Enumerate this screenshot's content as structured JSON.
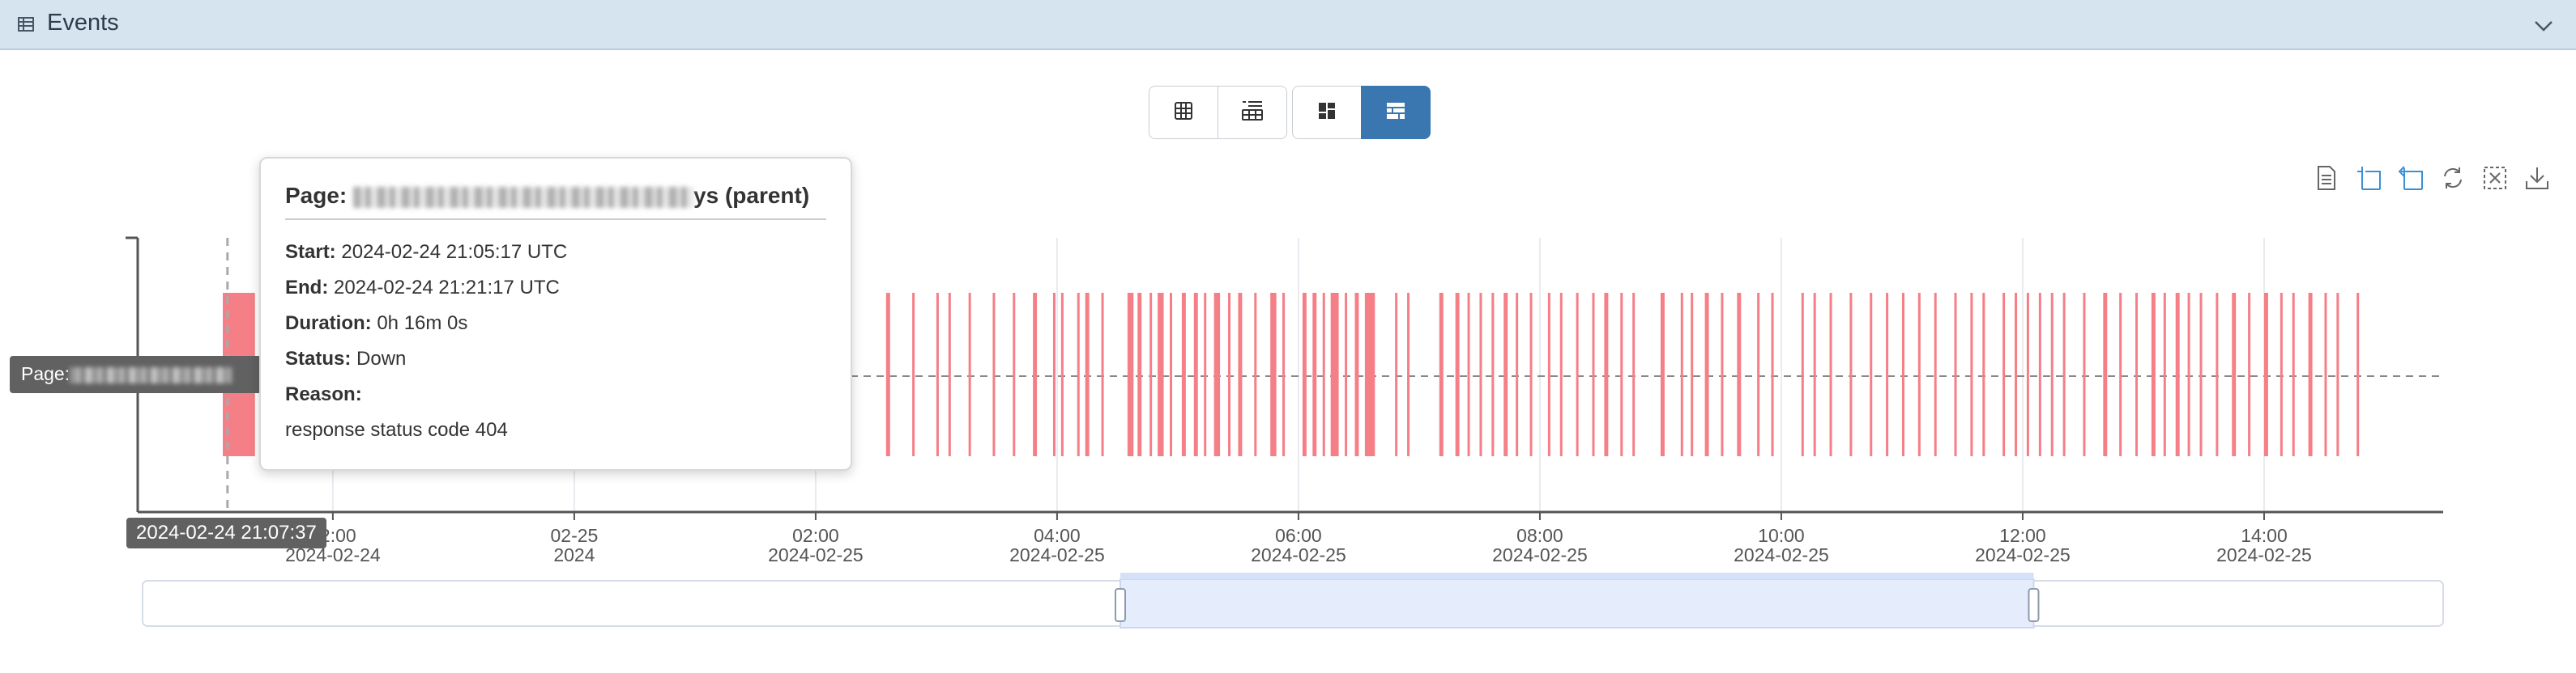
{
  "panel": {
    "title": "Events"
  },
  "view_buttons": [
    {
      "icon": "table-grid-icon",
      "active": false
    },
    {
      "icon": "table-list-icon",
      "active": false
    },
    {
      "icon": "dashboard-tiles-icon",
      "active": false
    },
    {
      "icon": "timeline-grid-icon",
      "active": true
    }
  ],
  "toolbox": [
    {
      "icon": "data-view-icon"
    },
    {
      "icon": "zoom-select-icon"
    },
    {
      "icon": "zoom-reset-icon"
    },
    {
      "icon": "restore-icon"
    },
    {
      "icon": "clear-selection-icon"
    },
    {
      "icon": "download-icon"
    }
  ],
  "tooltip": {
    "title_prefix": "Page: ",
    "title_suffix": "ys (parent)",
    "start_label": "Start:",
    "start_value": "2024-02-24 21:05:17 UTC",
    "end_label": "End:",
    "end_value": "2024-02-24 21:21:17 UTC",
    "duration_label": "Duration:",
    "duration_value": "0h 16m 0s",
    "status_label": "Status:",
    "status_value": "Down",
    "reason_label": "Reason:",
    "reason_value": "response status code 404"
  },
  "axis_pointer_label": "2024-02-24 21:07:37",
  "row_label_prefix": "Page:",
  "colors": {
    "accent": "#3a76b0",
    "event": "#f57f87",
    "zoom_fill": "#e5edfc"
  },
  "chart_data": {
    "type": "bar",
    "series": [
      {
        "status": "Down"
      }
    ],
    "x_ticks": [
      {
        "time": "2024-02-24 22:00",
        "line1": "22:00",
        "line2": "2024-02-24"
      },
      {
        "time": "2024-02-25 00:00",
        "line1": "02-25",
        "line2": "2024"
      },
      {
        "time": "2024-02-25 02:00",
        "line1": "02:00",
        "line2": "2024-02-25"
      },
      {
        "time": "2024-02-25 04:00",
        "line1": "04:00",
        "line2": "2024-02-25"
      },
      {
        "time": "2024-02-25 06:00",
        "line1": "06:00",
        "line2": "2024-02-25"
      },
      {
        "time": "2024-02-25 08:00",
        "line1": "08:00",
        "line2": "2024-02-25"
      },
      {
        "time": "2024-02-25 10:00",
        "line1": "10:00",
        "line2": "2024-02-25"
      },
      {
        "time": "2024-02-25 12:00",
        "line1": "12:00",
        "line2": "2024-02-25"
      },
      {
        "time": "2024-02-25 14:00",
        "line1": "14:00",
        "line2": "2024-02-25"
      }
    ],
    "x_range": [
      "2024-02-24 20:23",
      "2024-02-25 15:29"
    ],
    "pointer_time": "2024-02-24 21:07:37",
    "zoom_window": {
      "start_fraction": 0.425,
      "end_fraction": 0.822
    },
    "events": [
      {
        "start": "2024-02-24 21:05:17",
        "end": "2024-02-24 21:21:17"
      },
      {
        "start": "2024-02-25 02:35",
        "end": "2024-02-25 02:37"
      },
      {
        "start": "2024-02-25 02:48",
        "end": "2024-02-25 02:49"
      },
      {
        "start": "2024-02-25 03:00",
        "end": "2024-02-25 03:01"
      },
      {
        "start": "2024-02-25 03:06",
        "end": "2024-02-25 03:07"
      },
      {
        "start": "2024-02-25 03:16",
        "end": "2024-02-25 03:17"
      },
      {
        "start": "2024-02-25 03:28",
        "end": "2024-02-25 03:29"
      },
      {
        "start": "2024-02-25 03:38",
        "end": "2024-02-25 03:39"
      },
      {
        "start": "2024-02-25 03:48",
        "end": "2024-02-25 03:50"
      },
      {
        "start": "2024-02-25 03:58",
        "end": "2024-02-25 03:59"
      },
      {
        "start": "2024-02-25 04:02",
        "end": "2024-02-25 04:03"
      },
      {
        "start": "2024-02-25 04:10",
        "end": "2024-02-25 04:11"
      },
      {
        "start": "2024-02-25 04:14",
        "end": "2024-02-25 04:16"
      },
      {
        "start": "2024-02-25 04:22",
        "end": "2024-02-25 04:23"
      },
      {
        "start": "2024-02-25 04:35",
        "end": "2024-02-25 04:38"
      },
      {
        "start": "2024-02-25 04:40",
        "end": "2024-02-25 04:42"
      },
      {
        "start": "2024-02-25 04:46",
        "end": "2024-02-25 04:47"
      },
      {
        "start": "2024-02-25 04:50",
        "end": "2024-02-25 04:53"
      },
      {
        "start": "2024-02-25 04:56",
        "end": "2024-02-25 04:57"
      },
      {
        "start": "2024-02-25 05:02",
        "end": "2024-02-25 05:04"
      },
      {
        "start": "2024-02-25 05:08",
        "end": "2024-02-25 05:10"
      },
      {
        "start": "2024-02-25 05:13",
        "end": "2024-02-25 05:14"
      },
      {
        "start": "2024-02-25 05:18",
        "end": "2024-02-25 05:21"
      },
      {
        "start": "2024-02-25 05:25",
        "end": "2024-02-25 05:26"
      },
      {
        "start": "2024-02-25 05:30",
        "end": "2024-02-25 05:32"
      },
      {
        "start": "2024-02-25 05:38",
        "end": "2024-02-25 05:39"
      },
      {
        "start": "2024-02-25 05:46",
        "end": "2024-02-25 05:49"
      },
      {
        "start": "2024-02-25 05:52",
        "end": "2024-02-25 05:53"
      },
      {
        "start": "2024-02-25 06:02",
        "end": "2024-02-25 06:04"
      },
      {
        "start": "2024-02-25 06:07",
        "end": "2024-02-25 06:09"
      },
      {
        "start": "2024-02-25 06:12",
        "end": "2024-02-25 06:13"
      },
      {
        "start": "2024-02-25 06:16",
        "end": "2024-02-25 06:20"
      },
      {
        "start": "2024-02-25 06:23",
        "end": "2024-02-25 06:24"
      },
      {
        "start": "2024-02-25 06:28",
        "end": "2024-02-25 06:30"
      },
      {
        "start": "2024-02-25 06:33",
        "end": "2024-02-25 06:38"
      },
      {
        "start": "2024-02-25 06:48",
        "end": "2024-02-25 06:49"
      },
      {
        "start": "2024-02-25 06:54",
        "end": "2024-02-25 06:55"
      },
      {
        "start": "2024-02-25 07:10",
        "end": "2024-02-25 07:12"
      },
      {
        "start": "2024-02-25 07:18",
        "end": "2024-02-25 07:20"
      },
      {
        "start": "2024-02-25 07:24",
        "end": "2024-02-25 07:25"
      },
      {
        "start": "2024-02-25 07:30",
        "end": "2024-02-25 07:31"
      },
      {
        "start": "2024-02-25 07:36",
        "end": "2024-02-25 07:37"
      },
      {
        "start": "2024-02-25 07:42",
        "end": "2024-02-25 07:44"
      },
      {
        "start": "2024-02-25 07:48",
        "end": "2024-02-25 07:49"
      },
      {
        "start": "2024-02-25 07:55",
        "end": "2024-02-25 07:56"
      },
      {
        "start": "2024-02-25 08:04",
        "end": "2024-02-25 08:05"
      },
      {
        "start": "2024-02-25 08:10",
        "end": "2024-02-25 08:11"
      },
      {
        "start": "2024-02-25 08:18",
        "end": "2024-02-25 08:19"
      },
      {
        "start": "2024-02-25 08:26",
        "end": "2024-02-25 08:27"
      },
      {
        "start": "2024-02-25 08:32",
        "end": "2024-02-25 08:34"
      },
      {
        "start": "2024-02-25 08:40",
        "end": "2024-02-25 08:41"
      },
      {
        "start": "2024-02-25 08:46",
        "end": "2024-02-25 08:47"
      },
      {
        "start": "2024-02-25 09:00",
        "end": "2024-02-25 09:02"
      },
      {
        "start": "2024-02-25 09:10",
        "end": "2024-02-25 09:11"
      },
      {
        "start": "2024-02-25 09:15",
        "end": "2024-02-25 09:16"
      },
      {
        "start": "2024-02-25 09:22",
        "end": "2024-02-25 09:24"
      },
      {
        "start": "2024-02-25 09:30",
        "end": "2024-02-25 09:31"
      },
      {
        "start": "2024-02-25 09:38",
        "end": "2024-02-25 09:40"
      },
      {
        "start": "2024-02-25 09:48",
        "end": "2024-02-25 09:49"
      },
      {
        "start": "2024-02-25 09:55",
        "end": "2024-02-25 09:56"
      },
      {
        "start": "2024-02-25 10:10",
        "end": "2024-02-25 10:11"
      },
      {
        "start": "2024-02-25 10:16",
        "end": "2024-02-25 10:17"
      },
      {
        "start": "2024-02-25 10:24",
        "end": "2024-02-25 10:25"
      },
      {
        "start": "2024-02-25 10:34",
        "end": "2024-02-25 10:35"
      },
      {
        "start": "2024-02-25 10:44",
        "end": "2024-02-25 10:45"
      },
      {
        "start": "2024-02-25 10:52",
        "end": "2024-02-25 10:53"
      },
      {
        "start": "2024-02-25 11:00",
        "end": "2024-02-25 11:01"
      },
      {
        "start": "2024-02-25 11:08",
        "end": "2024-02-25 11:09"
      },
      {
        "start": "2024-02-25 11:16",
        "end": "2024-02-25 11:17"
      },
      {
        "start": "2024-02-25 11:26",
        "end": "2024-02-25 11:27"
      },
      {
        "start": "2024-02-25 11:34",
        "end": "2024-02-25 11:35"
      },
      {
        "start": "2024-02-25 11:40",
        "end": "2024-02-25 11:41"
      },
      {
        "start": "2024-02-25 11:50",
        "end": "2024-02-25 11:51"
      },
      {
        "start": "2024-02-25 11:56",
        "end": "2024-02-25 11:57"
      },
      {
        "start": "2024-02-25 12:02",
        "end": "2024-02-25 12:03"
      },
      {
        "start": "2024-02-25 12:08",
        "end": "2024-02-25 12:09"
      },
      {
        "start": "2024-02-25 12:14",
        "end": "2024-02-25 12:15"
      },
      {
        "start": "2024-02-25 12:20",
        "end": "2024-02-25 12:21"
      },
      {
        "start": "2024-02-25 12:30",
        "end": "2024-02-25 12:31"
      },
      {
        "start": "2024-02-25 12:40",
        "end": "2024-02-25 12:42"
      },
      {
        "start": "2024-02-25 12:48",
        "end": "2024-02-25 12:49"
      },
      {
        "start": "2024-02-25 12:56",
        "end": "2024-02-25 12:57"
      },
      {
        "start": "2024-02-25 13:04",
        "end": "2024-02-25 13:06"
      },
      {
        "start": "2024-02-25 13:10",
        "end": "2024-02-25 13:11"
      },
      {
        "start": "2024-02-25 13:16",
        "end": "2024-02-25 13:18"
      },
      {
        "start": "2024-02-25 13:22",
        "end": "2024-02-25 13:23"
      },
      {
        "start": "2024-02-25 13:28",
        "end": "2024-02-25 13:29"
      },
      {
        "start": "2024-02-25 13:36",
        "end": "2024-02-25 13:37"
      },
      {
        "start": "2024-02-25 13:44",
        "end": "2024-02-25 13:46"
      },
      {
        "start": "2024-02-25 13:52",
        "end": "2024-02-25 13:53"
      },
      {
        "start": "2024-02-25 14:00",
        "end": "2024-02-25 14:02"
      },
      {
        "start": "2024-02-25 14:08",
        "end": "2024-02-25 14:09"
      },
      {
        "start": "2024-02-25 14:14",
        "end": "2024-02-25 14:15"
      },
      {
        "start": "2024-02-25 14:22",
        "end": "2024-02-25 14:24"
      },
      {
        "start": "2024-02-25 14:30",
        "end": "2024-02-25 14:31"
      },
      {
        "start": "2024-02-25 14:36",
        "end": "2024-02-25 14:37"
      },
      {
        "start": "2024-02-25 14:46",
        "end": "2024-02-25 14:47"
      }
    ]
  }
}
